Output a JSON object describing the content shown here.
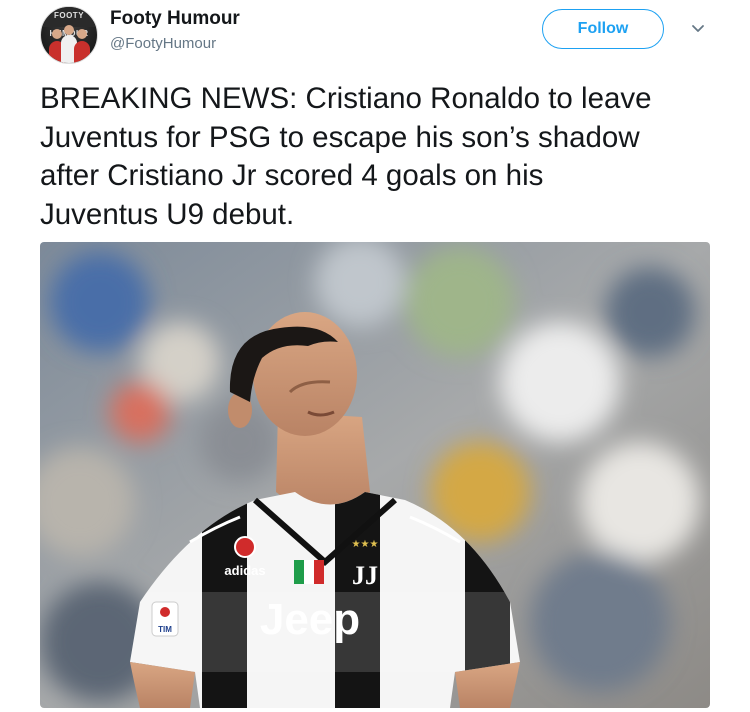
{
  "author": {
    "display_name": "Footy Humour",
    "handle": "@FootyHumour",
    "avatar_text": "FOOTY HUMOUR"
  },
  "actions": {
    "follow_label": "Follow"
  },
  "tweet": {
    "text": "BREAKING NEWS: Cristiano Ronaldo to leave\nJuventus for PSG to escape his son’s shadow\nafter Cristiano Jr scored 4 goals on his\nJuventus U9 debut."
  },
  "media": {
    "shirt_sponsor": "Jeep",
    "kit_brand": "adidas",
    "league_badge": "TIM"
  },
  "colors": {
    "accent": "#1da1f2",
    "text": "#14171a",
    "secondary_text": "#657786"
  },
  "icons": {
    "caret": "chevron-down-icon"
  }
}
